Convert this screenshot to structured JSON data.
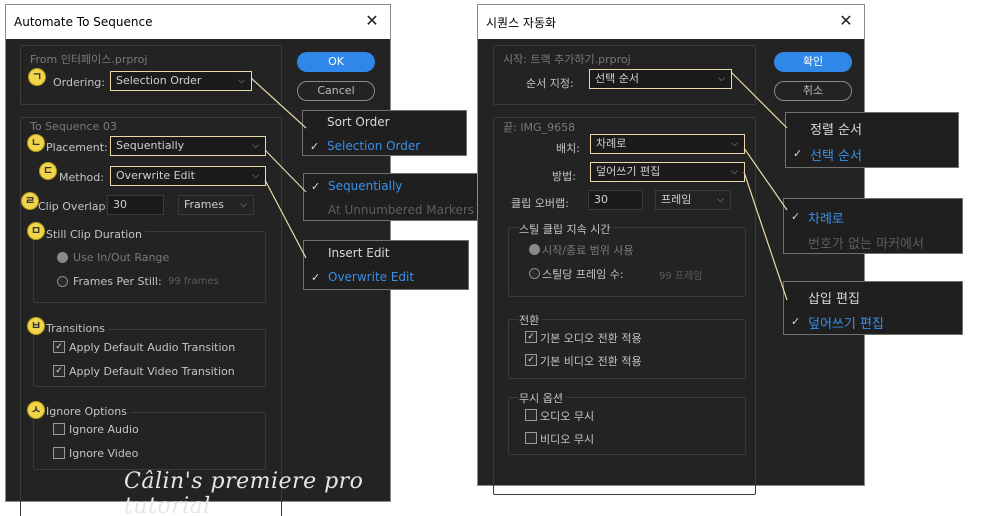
{
  "english": {
    "title": "Automate To Sequence",
    "from_label": "From 인터페이스.prproj",
    "ordering_label": "Ordering:",
    "ordering_value": "Selection Order",
    "ok": "OK",
    "cancel": "Cancel",
    "to_sequence": "To Sequence 03",
    "placement_label": "Placement:",
    "placement_value": "Sequentially",
    "method_label": "Method:",
    "method_value": "Overwrite Edit",
    "clip_overlap_label": "Clip Overlap:",
    "clip_overlap_value": "30",
    "clip_overlap_unit": "Frames",
    "still_clip_duration": "Still Clip Duration",
    "use_in_out": "Use In/Out Range",
    "frames_per_still": "Frames Per Still:",
    "frames_value": "99 frames",
    "transitions": "Transitions",
    "apply_audio": "Apply Default Audio Transition",
    "apply_video": "Apply Default Video Transition",
    "ignore_options": "Ignore Options",
    "ignore_audio": "Ignore Audio",
    "ignore_video": "Ignore Video",
    "watermark": "Câlin's premiere pro tutorial"
  },
  "markers": [
    "ㄱ",
    "ㄴ",
    "ㄷ",
    "ㄹ",
    "ㅁ",
    "ㅂ",
    "ㅅ"
  ],
  "english_menus": {
    "ordering": [
      "Sort Order",
      "Selection Order"
    ],
    "placement": [
      "Sequentially",
      "At Unnumbered Markers"
    ],
    "method": [
      "Insert Edit",
      "Overwrite Edit"
    ]
  },
  "korean": {
    "title": "시퀀스 자동화",
    "from_label": "시작: 트랙 추가하기.prproj",
    "ordering_label": "순서 지정:",
    "ordering_value": "선택 순서",
    "ok": "확인",
    "cancel": "취소",
    "to_sequence": "끝: IMG_9658",
    "placement_label": "배치:",
    "placement_value": "차례로",
    "method_label": "방법:",
    "method_value": "덮어쓰기 편집",
    "clip_overlap_label": "클립 오버랩:",
    "clip_overlap_value": "30",
    "clip_overlap_unit": "프레임",
    "still_clip_duration": "스틸 클립 지속 시간",
    "use_in_out": "시작/종료 범위 사용",
    "frames_per_still": "스틸당 프레임 수:",
    "frames_value": "99 프레임",
    "transitions": "전환",
    "apply_audio": "기본 오디오 전환 적용",
    "apply_video": "기본 비디오 전환 적용",
    "ignore_options": "무시 옵션",
    "ignore_audio": "오디오 무시",
    "ignore_video": "비디오 무시"
  },
  "korean_menus": {
    "ordering": [
      "정렬 순서",
      "선택 순서"
    ],
    "placement": [
      "차례로",
      "번호가 없는 마커에서"
    ],
    "method": [
      "삽입 편집",
      "덮어쓰기 편집"
    ]
  },
  "colors": {
    "accent_blue": "#2f88e8",
    "selected_item": "#3a8fe8",
    "dialog_bg": "#232323",
    "highlight_border": "#e9d9a8",
    "marker": "#f0d44a"
  }
}
